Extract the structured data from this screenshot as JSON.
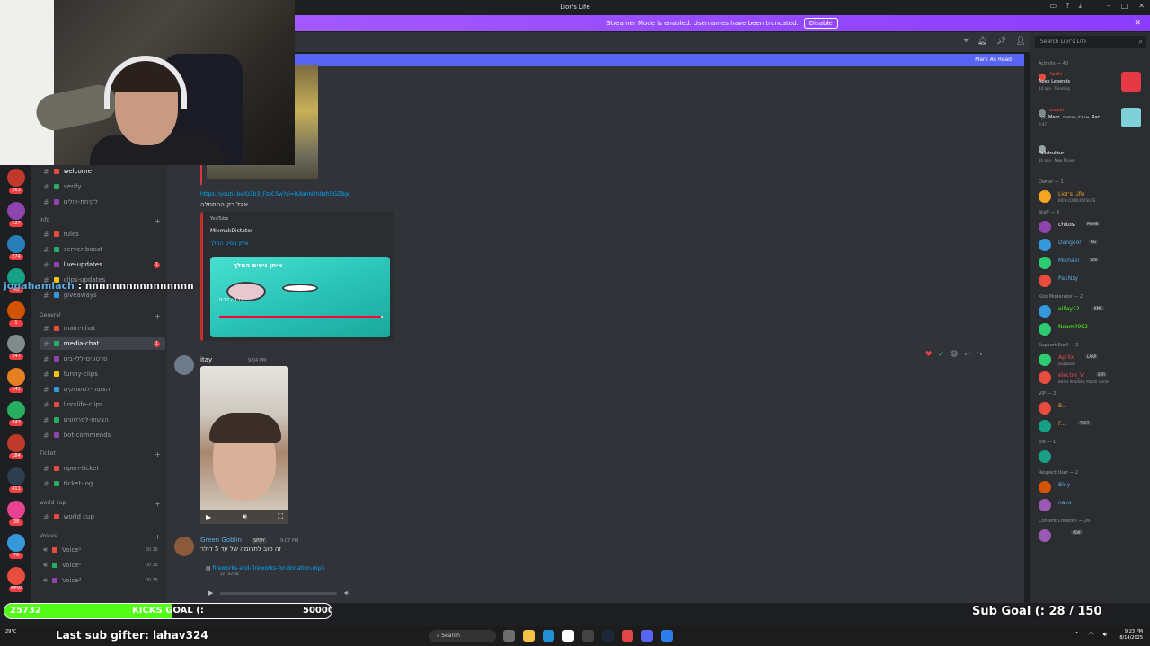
{
  "window": {
    "title": "Lior's Life"
  },
  "banner": {
    "text": "Streamer Mode is enabled. Usernames have been truncated.",
    "disable_label": "Disable"
  },
  "toolbar": {
    "mark_as_read": "Mark As Read"
  },
  "search": {
    "placeholder": "Search Lior's Life"
  },
  "channels": {
    "top": [
      {
        "name": "welcome",
        "unread": true
      },
      {
        "name": "verify"
      },
      {
        "name": "לקיחת-רולים"
      }
    ],
    "cat_info": "Info",
    "info": [
      {
        "name": "rules"
      },
      {
        "name": "server-boost"
      },
      {
        "name": "live-updates",
        "unread": true,
        "badge": "1"
      },
      {
        "name": "clips-updates"
      },
      {
        "name": "giveaways"
      }
    ],
    "cat_general": "General",
    "general": [
      {
        "name": "main-chat"
      },
      {
        "name": "media-chat",
        "active": true,
        "badge": "1"
      },
      {
        "name": "סרטונים-ללי-בים"
      },
      {
        "name": "funny-clips"
      },
      {
        "name": "הצעות-למשחקים"
      },
      {
        "name": "liorslife-clips"
      },
      {
        "name": "הצעות-לסרטונים"
      },
      {
        "name": "bot-commends"
      }
    ],
    "cat_ticket": "Ticket",
    "ticket": [
      {
        "name": "open-ticket"
      },
      {
        "name": "ticket-log"
      }
    ],
    "cat_worldcup": "world cup",
    "worldcup": [
      {
        "name": "world cup"
      }
    ],
    "cat_voices": "Voices",
    "voices": [
      {
        "name": "Voice¹",
        "count": "00 15"
      },
      {
        "name": "Voice²",
        "count": "00 15"
      },
      {
        "name": "Voice³",
        "count": "00 15"
      }
    ]
  },
  "server_badges": [
    "263",
    "127",
    "274",
    "48",
    "1",
    "247",
    "141",
    "343",
    "184",
    "411",
    "38",
    "76",
    "NEW"
  ],
  "messages": {
    "link": "https://youtu.be/Q3b3_FzsC5w?si=lUbmN2h9zh5GZBgi",
    "link_caption": "אבל רק ההתחלה",
    "embed": {
      "provider": "YouTube",
      "author": "MikmakDictator",
      "title": "איתן ניסים המלך",
      "video_title": "איתן ניסים המלך",
      "time": "0:12 / 0:12"
    },
    "msg2": {
      "user": "itay",
      "time": "9:04 PM"
    },
    "msg3": {
      "user": "Green Goblin",
      "tag": "SPDY",
      "time": "9:07 PM",
      "text": "זה טוב לתרומה של עד 5 דולר",
      "file": "fireworks-and-fireworks-for-donation.mp3",
      "file_size": "327.92 KB"
    }
  },
  "chat_overlay": {
    "user": "jonahamlach",
    "text": ": חחחחחחחחחחחחחחחח"
  },
  "members": {
    "activity_header": "Activity — 40",
    "activities": [
      {
        "user": "Aprilx",
        "game": "Apex Legends",
        "sub": "1d ago · Trending"
      },
      {
        "user": "suzuki",
        "game": "קבן, Maor, אהבה, אבירה, Rac...",
        "sub": "0:47"
      },
      {
        "user": "",
        "game": "Fallstruktur",
        "sub": "1h ago · New Player"
      }
    ],
    "groups": [
      {
        "label": "Owner — 1",
        "items": [
          {
            "name": "Lior's Life",
            "sub": "KICK.COM/LIORSLIFE",
            "color": "#f5a623"
          }
        ]
      },
      {
        "label": "Staff — 4",
        "items": [
          {
            "name": "chitos",
            "tag": "PRIME",
            "color": "#ffffff"
          },
          {
            "name": "Dangoor",
            "tag": "GG",
            "color": "#5dade2"
          },
          {
            "name": "Michael",
            "tag": "Life",
            "color": "#5dade2"
          },
          {
            "name": "Pa1Nzy",
            "color": "#5dade2"
          }
        ]
      },
      {
        "label": "Kick Moderator — 2",
        "items": [
          {
            "name": "eillay22",
            "tag": "KMC",
            "color": "#53fc18"
          },
          {
            "name": "Noam4992",
            "color": "#53fc18"
          }
        ]
      },
      {
        "label": "Support Staff — 2",
        "items": [
          {
            "name": "Aprilx",
            "tag": "LARP",
            "sub": "Outposts",
            "color": "#e84855"
          },
          {
            "name": "electro_V",
            "tag": "SVR",
            "sub": "Beats Rhymes, Match Cards",
            "color": "#e84855"
          }
        ]
      },
      {
        "label": "VIP — 2",
        "items": [
          {
            "name": "B...",
            "color": "#f5a623"
          },
          {
            "name": "F...",
            "tag": "TRCT",
            "color": "#f5a623"
          }
        ]
      },
      {
        "label": "OG — 1",
        "items": [
          {
            "name": "",
            "color": "#2ecc71"
          }
        ]
      },
      {
        "label": "Respect User — 2",
        "items": [
          {
            "name": "Bluy",
            "color": "#5dade2"
          },
          {
            "name": "navo",
            "color": "#5dade2"
          }
        ]
      },
      {
        "label": "Content Creators — 26",
        "items": [
          {
            "name": "",
            "tag": "ADIF",
            "color": "#e84855"
          }
        ]
      }
    ]
  },
  "overlay": {
    "goal_current": "25732",
    "goal_label": "KICKS GOAL (:",
    "goal_target": "50000",
    "goal_fraction": 0.515,
    "last_sub": "Last sub gifter: lahav324",
    "sub_goal": "Sub Goal (: 28 / 150"
  },
  "taskbar": {
    "weather": "29°C",
    "search": "Search",
    "time": "9:23 PM",
    "date": "8/14/2025"
  }
}
